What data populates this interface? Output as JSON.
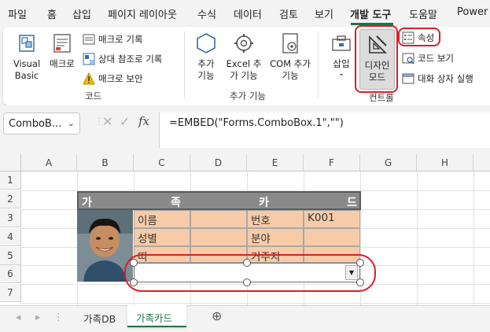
{
  "ribbon_tabs": [
    "파일",
    "홈",
    "삽입",
    "페이지 레이아웃",
    "수식",
    "데이터",
    "검토",
    "보기",
    "개발 도구",
    "도움말",
    "Power"
  ],
  "active_tab": "개발 도구",
  "ribbon": {
    "code_group": {
      "visual_basic": "Visual Basic",
      "macros": "매크로",
      "record_macro": "매크로 기록",
      "relative_refs": "상대 참조로 기록",
      "macro_security": "매크로 보안",
      "label": "코드"
    },
    "addins_group": {
      "addins": "추가 기능",
      "excel_addins": "Excel 추가 기능",
      "com_addins": "COM 추가 기능",
      "label": "추가 기능"
    },
    "controls_group": {
      "insert": "삽입",
      "design_mode": "디자인 모드",
      "properties": "속성",
      "view_code": "코드 보기",
      "run_dialog": "대화 상자 실행",
      "label": "컨트롤"
    }
  },
  "formula_bar": {
    "name_box": "ComboB...",
    "formula": "=EMBED(\"Forms.ComboBox.1\",\"\")"
  },
  "columns": [
    "A",
    "B",
    "C",
    "D",
    "E",
    "F",
    "G",
    "H"
  ],
  "rows": [
    "1",
    "2",
    "3",
    "4",
    "5",
    "6",
    "7"
  ],
  "sheet": {
    "title_chars": [
      "가",
      "족",
      "카",
      "드"
    ],
    "labels": {
      "name": "이름",
      "gender": "성별",
      "zodiac": "띠",
      "number": "번호",
      "category": "분야",
      "residence": "거주지"
    },
    "number_value": "K001"
  },
  "sheet_tabs": [
    "가족DB",
    "가족카드"
  ],
  "active_sheet": "가족카드",
  "colors": {
    "accent": "#217346",
    "highlight": "#e01b24",
    "orange_cell": "#f8cba8",
    "title_bg": "#8a8a8a"
  }
}
